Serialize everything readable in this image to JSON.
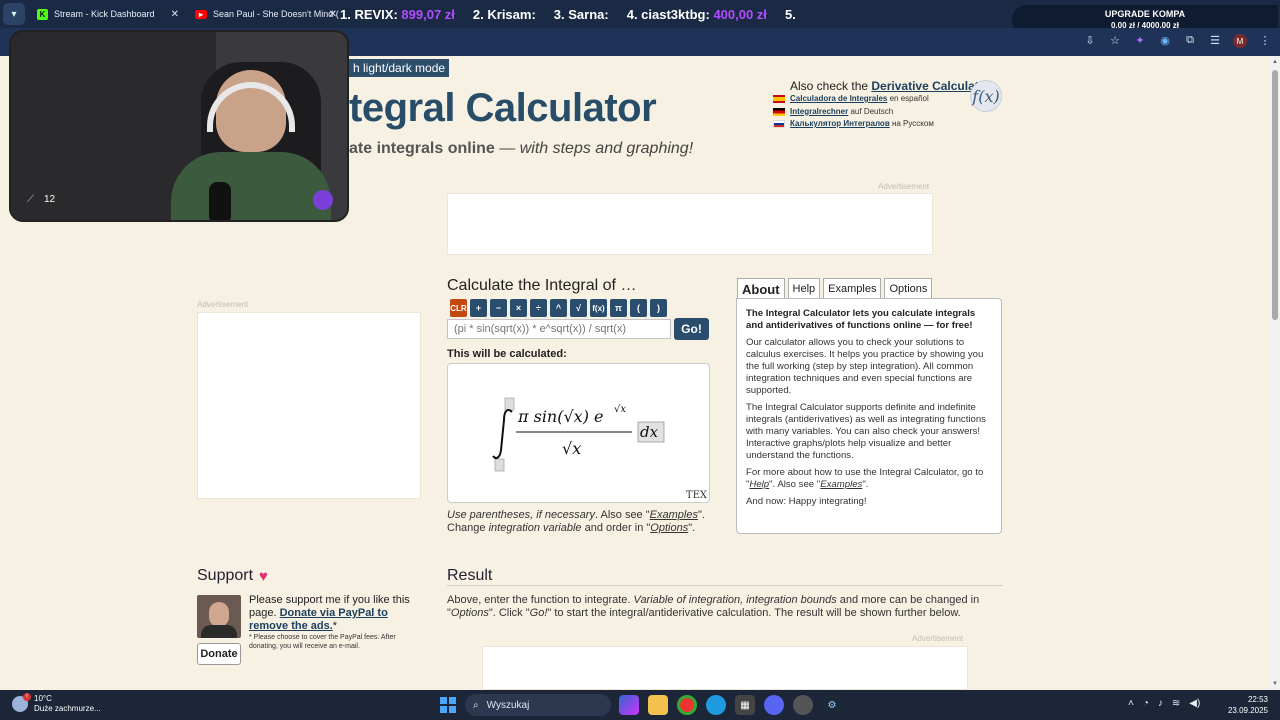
{
  "browser": {
    "tabs": [
      {
        "title": "Stream - Kick Dashboard",
        "icon": "kick-icon",
        "color": "#53fc18"
      },
      {
        "title": "Sean Paul - She Doesn't Mind (",
        "icon": "youtube-icon",
        "color": "#ff0000"
      }
    ],
    "overlay_ranking": [
      {
        "rank": "1. REVIX:",
        "amount": "899,07 zł"
      },
      {
        "rank": "2. Krisam:",
        "amount": ""
      },
      {
        "rank": "3. Sarna:",
        "amount": ""
      },
      {
        "rank": "4. ciast3ktbg:",
        "amount": "400,00 zł"
      },
      {
        "rank": "5.",
        "amount": ""
      }
    ],
    "upgrade": {
      "title": "UPGRADE KOMPA",
      "progress": "0,00 zł / 4000,00 zł"
    },
    "profile_initial": "M"
  },
  "webcam": {
    "viewer_count": "12"
  },
  "page": {
    "mode_switch": "h light/dark mode",
    "title": "tegral Calculator",
    "subtitle_strong": "ate integrals online",
    "subtitle_sep": " — ",
    "subtitle_em": "with steps and graphing!",
    "also_check_prefix": "Also check the ",
    "also_check_link": "Derivative Calculator",
    "also_check_suffix": "!",
    "languages": [
      {
        "link": "Calculadora de Integrales",
        "suffix": " en español",
        "flag_colors": [
          "#c60b1e",
          "#ffc400"
        ]
      },
      {
        "link": "Integralrechner",
        "suffix": " auf Deutsch",
        "flag_colors": [
          "#000000",
          "#dd0000"
        ]
      },
      {
        "link": "Калькулятор Интегралов",
        "suffix": " на Русском",
        "flag_colors": [
          "#ffffff",
          "#0039a6"
        ]
      }
    ],
    "fx_icon_text": "f(x)",
    "ad_label": "Advertisement",
    "calc": {
      "heading": "Calculate the Integral of …",
      "keys": [
        "CLR",
        "+",
        "−",
        "×",
        "÷",
        "^",
        "√",
        "f(x)",
        "π",
        "(",
        ")"
      ],
      "input_placeholder": "(pi * sin(sqrt(x)) * e^sqrt(x)) / sqrt(x)",
      "go_label": "Go!",
      "will_calc_label": "This will be calculated:",
      "tex_badge": "TEX",
      "hint_1a": "Use parentheses, ",
      "hint_1b": "if necessary",
      "hint_1c": ". Also see \"",
      "hint_examples": "Examples",
      "hint_1d": "\".",
      "hint_2a": "Change ",
      "hint_2b": "integration variable",
      "hint_2c": " and order in \"",
      "hint_options": "Options",
      "hint_2d": "\"."
    },
    "about_tabs": [
      "About",
      "Help",
      "Examples",
      "Options"
    ],
    "about": {
      "lead": "The Integral Calculator lets you calculate integrals and antiderivatives of functions online — for free!",
      "p1": "Our calculator allows you to check your solutions to calculus exercises. It helps you practice by showing you the full working (step by step integration). All common integration techniques and even special functions are supported.",
      "p2": "The Integral Calculator supports definite and indefinite integrals (antiderivatives) as well as integrating functions with many variables. You can also check your answers! Interactive graphs/plots help visualize and better understand the functions.",
      "p3a": "For more about how to use the Integral Calculator, go to \"",
      "p3_help": "Help",
      "p3b": "\". Also see \"",
      "p3_examples": "Examples",
      "p3c": "\".",
      "p4": "And now: Happy integrating!"
    },
    "support": {
      "heading": "Support",
      "text_a": "Please support me if you like this page. ",
      "text_link": "Donate via PayPal to remove the ads.",
      "text_b": "*",
      "note": "* Please choose to cover the PayPal fees. After donating, you will receive an e-mail.",
      "donate_label": "Donate"
    },
    "result": {
      "heading": "Result",
      "t1": "Above, enter the function to integrate. ",
      "t2": "Variable of integration, integration bounds",
      "t3": " and more can be changed in \"",
      "t4": "Options",
      "t5": "\". Click \"",
      "t6": "Go!",
      "t7": "\" to start the integral/antiderivative calculation. The result will be shown further below."
    }
  },
  "taskbar": {
    "weather_temp": "10°C",
    "weather_desc": "Duże zachmurze...",
    "search_placeholder": "Wyszukaj",
    "time": "22:53",
    "date": "23.09.2025"
  },
  "colors": {
    "accent": "#2a4d6e",
    "title": "#274d68",
    "page_bg": "#f7f1e3",
    "clr_key": "#c24a10"
  }
}
